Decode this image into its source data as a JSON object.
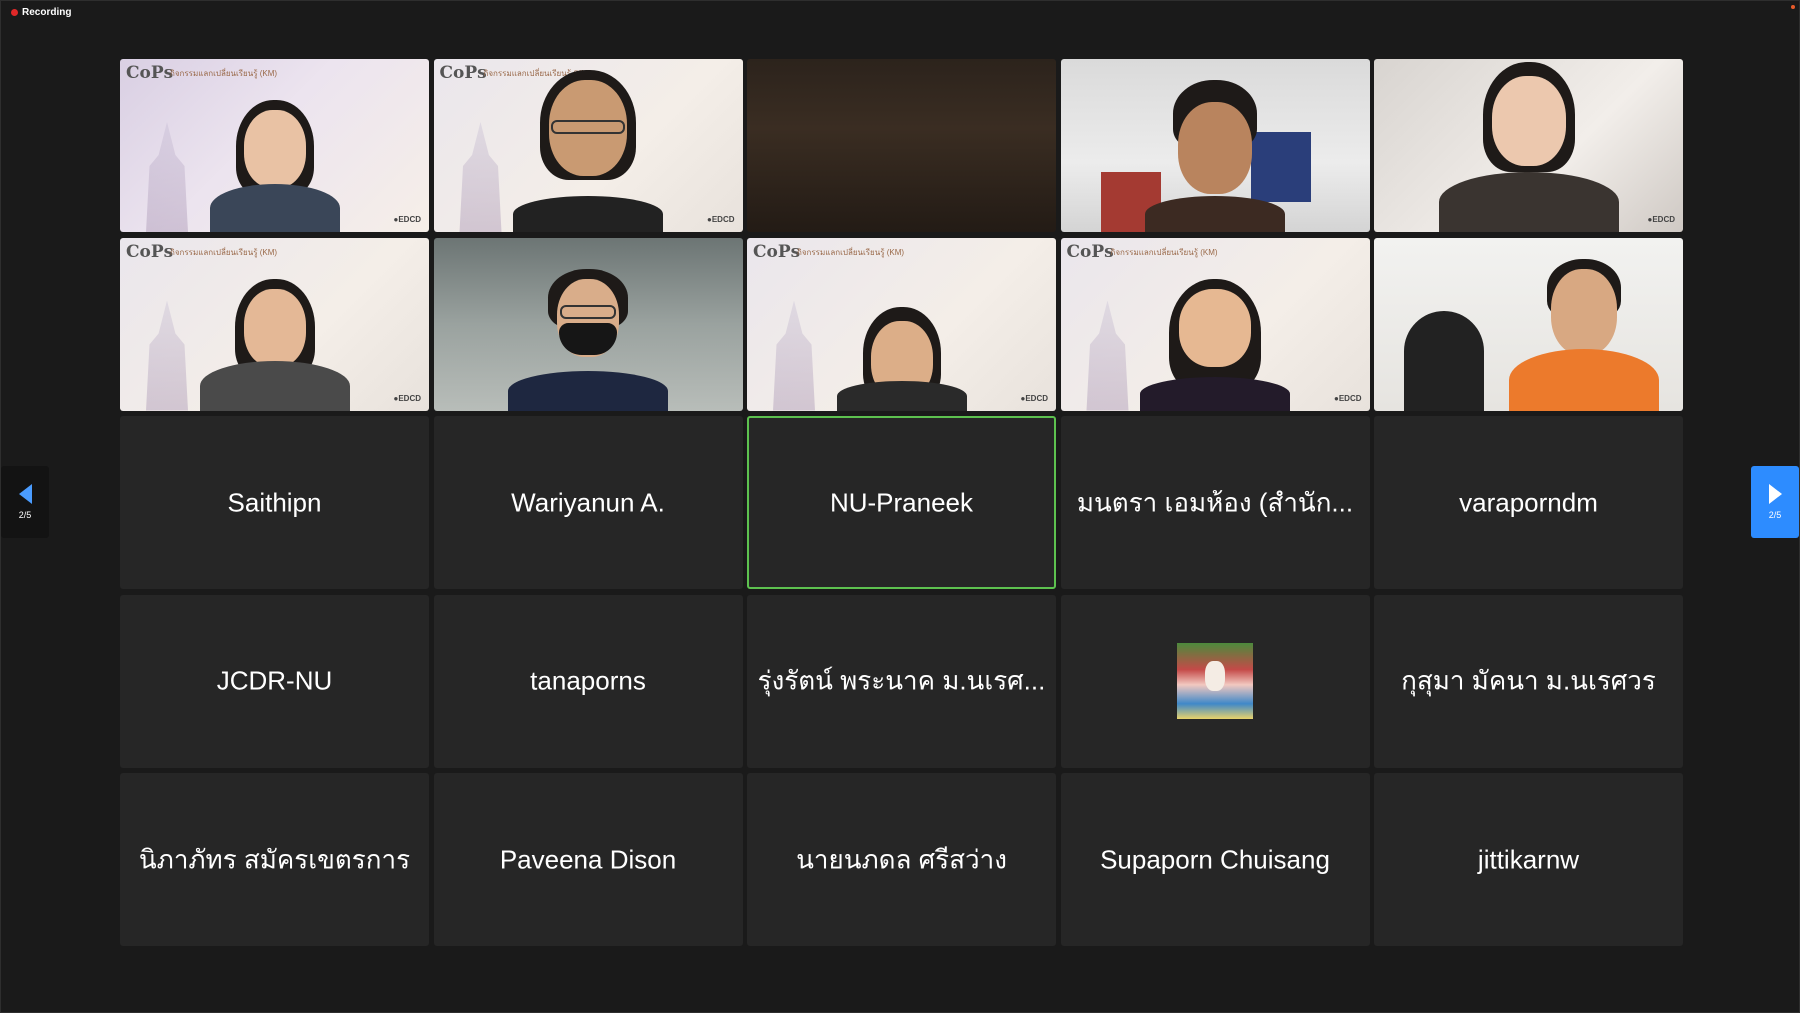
{
  "recording": {
    "label": "Recording"
  },
  "pagination": {
    "prev_page": "2/5",
    "next_page": "2/5"
  },
  "video_tiles": [
    {
      "overlay_brand": "CoPs",
      "overlay_subtitle": "กิจกรรมแลกเปลี่ยนเรียนรู้ (KM)"
    },
    {
      "overlay_brand": "CoPs",
      "overlay_subtitle": "กิจกรรมแลกเปลี่ยนเรียนรู้ (KM)"
    },
    {
      "overlay_brand": "",
      "overlay_subtitle": ""
    },
    {
      "overlay_brand": "",
      "overlay_subtitle": ""
    },
    {
      "overlay_brand": "",
      "overlay_subtitle": ""
    },
    {
      "overlay_brand": "CoPs",
      "overlay_subtitle": "กิจกรรมแลกเปลี่ยนเรียนรู้ (KM)"
    },
    {
      "overlay_brand": "",
      "overlay_subtitle": ""
    },
    {
      "overlay_brand": "CoPs",
      "overlay_subtitle": "กิจกรรมแลกเปลี่ยนเรียนรู้ (KM)"
    },
    {
      "overlay_brand": "CoPs",
      "overlay_subtitle": "กิจกรรมแลกเปลี่ยนเรียนรู้ (KM)"
    },
    {
      "overlay_brand": "",
      "overlay_subtitle": ""
    }
  ],
  "name_tiles": [
    "Saithipn",
    "Wariyanun A.",
    "NU-Praneek",
    "มนตรา เอมห้อง (สำนัก...",
    "varaporndm",
    "JCDR-NU",
    "tanaporns",
    "รุ่งรัตน์ พระนาค ม.นเรศ...",
    "",
    "กุสุมา มัคนา ม.นเรศวร",
    "นิภาภัทร  สมัครเขตรการ",
    "Paveena Dison",
    "นายนภดล ศรีสว่าง",
    "Supaporn  Chuisang",
    "jittikarnw"
  ],
  "active_speaker": "NU-Praneek",
  "colors": {
    "active_border": "#5dc14f",
    "next_button": "#2d8cff",
    "recording_dot": "#e02828"
  }
}
